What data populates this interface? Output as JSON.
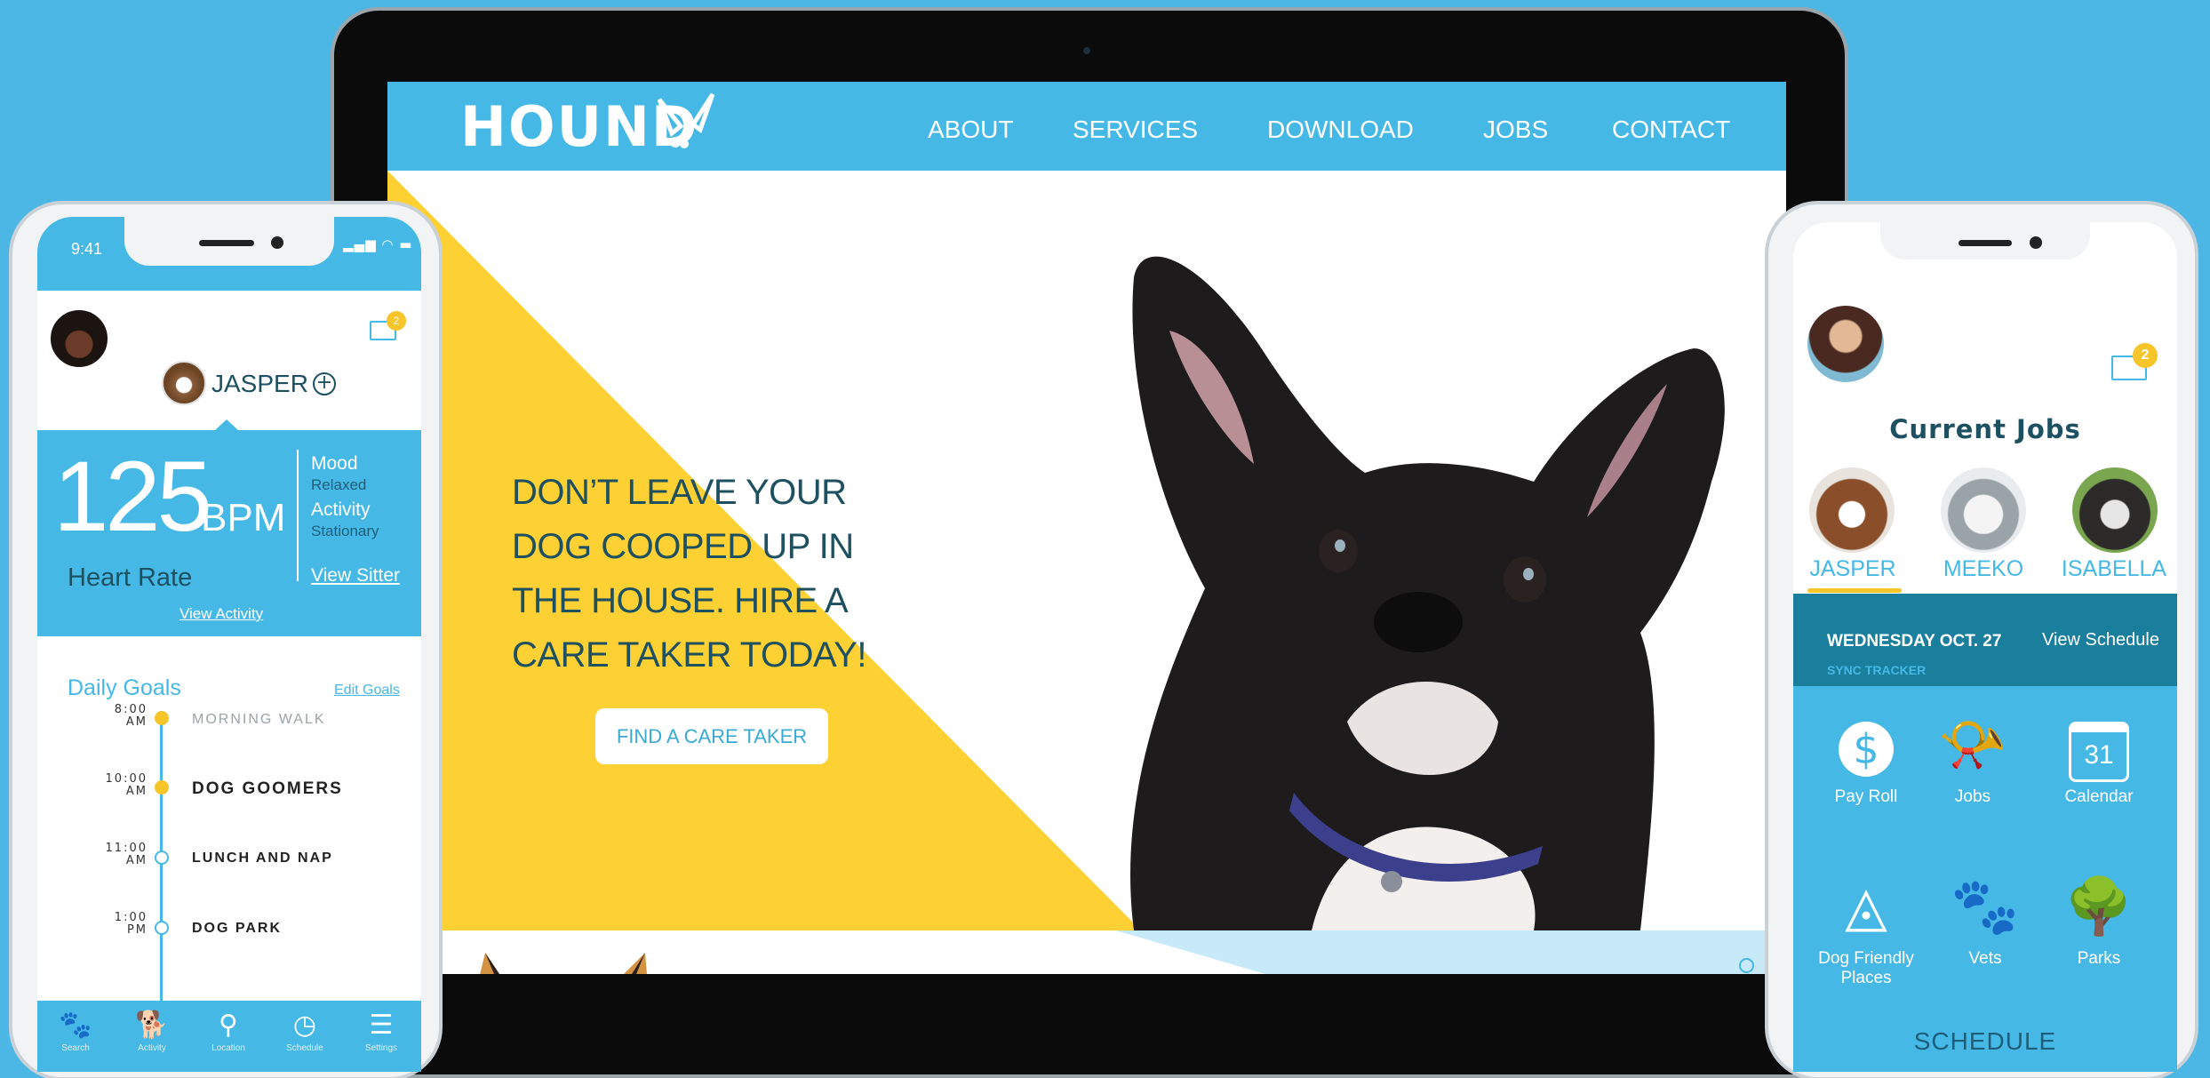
{
  "website": {
    "logo": "HOUND",
    "nav": [
      "ABOUT",
      "SERVICES",
      "DOWNLOAD",
      "JOBS",
      "CONTACT"
    ],
    "hero": {
      "headline": "DON’T LEAVE YOUR DOG COOPED UP IN THE HOUSE. HIRE A CARE TAKER TODAY!",
      "cta": "FIND A CARE TAKER"
    },
    "colors": {
      "brand": "#45b8e6",
      "yellow": "#fdd033",
      "light_blue": "#c7e9f8"
    }
  },
  "phone_left": {
    "time": "9:41",
    "mail_badge": "2",
    "dog_name": "JASPER",
    "heart_rate": {
      "value": "125",
      "unit": "BPM",
      "label": "Heart Rate"
    },
    "mood": {
      "label": "Mood",
      "value": "Relaxed"
    },
    "activity": {
      "label": "Activity",
      "value": "Stationary"
    },
    "view_sitter": "View Sitter",
    "view_activity": "View Activity",
    "goals_title": "Daily Goals",
    "edit_goals": "Edit Goals",
    "goals": [
      {
        "time_line1": "8:00",
        "time_line2": "AM",
        "task": "MORNING WALK",
        "done": true
      },
      {
        "time_line1": "10:00",
        "time_line2": "AM",
        "task": "DOG GOOMERS",
        "done": true
      },
      {
        "time_line1": "11:00",
        "time_line2": "AM",
        "task": "LUNCH AND NAP",
        "done": false
      },
      {
        "time_line1": "1:00",
        "time_line2": "PM",
        "task": "DOG PARK",
        "done": false
      }
    ],
    "tabs": [
      {
        "label": "Search",
        "icon": "dog-search-icon"
      },
      {
        "label": "Activity",
        "icon": "running-dog-icon"
      },
      {
        "label": "Location",
        "icon": "location-pin-icon"
      },
      {
        "label": "Schedule",
        "icon": "schedule-clock-icon"
      },
      {
        "label": "Settings",
        "icon": "menu-icon"
      }
    ]
  },
  "phone_right": {
    "mail_badge": "2",
    "title": "Current Jobs",
    "dogs": [
      "JASPER",
      "MEEKO",
      "ISABELLA"
    ],
    "schedule_date": "WEDNESDAY OCT. 27",
    "view_schedule": "View Schedule",
    "sync_tracker": "SYNC TRACKER",
    "grid": [
      {
        "label": "Pay Roll",
        "icon": "dollar-icon"
      },
      {
        "label": "Jobs",
        "icon": "whistle-icon"
      },
      {
        "label": "Calendar",
        "icon": "calendar-icon",
        "day": "31"
      },
      {
        "label": "Dog Friendly Places",
        "icon": "dog-face-icon"
      },
      {
        "label": "Vets",
        "icon": "paw-icon"
      },
      {
        "label": "Parks",
        "icon": "tree-icon"
      }
    ],
    "footer_title": "SCHEDULE"
  }
}
